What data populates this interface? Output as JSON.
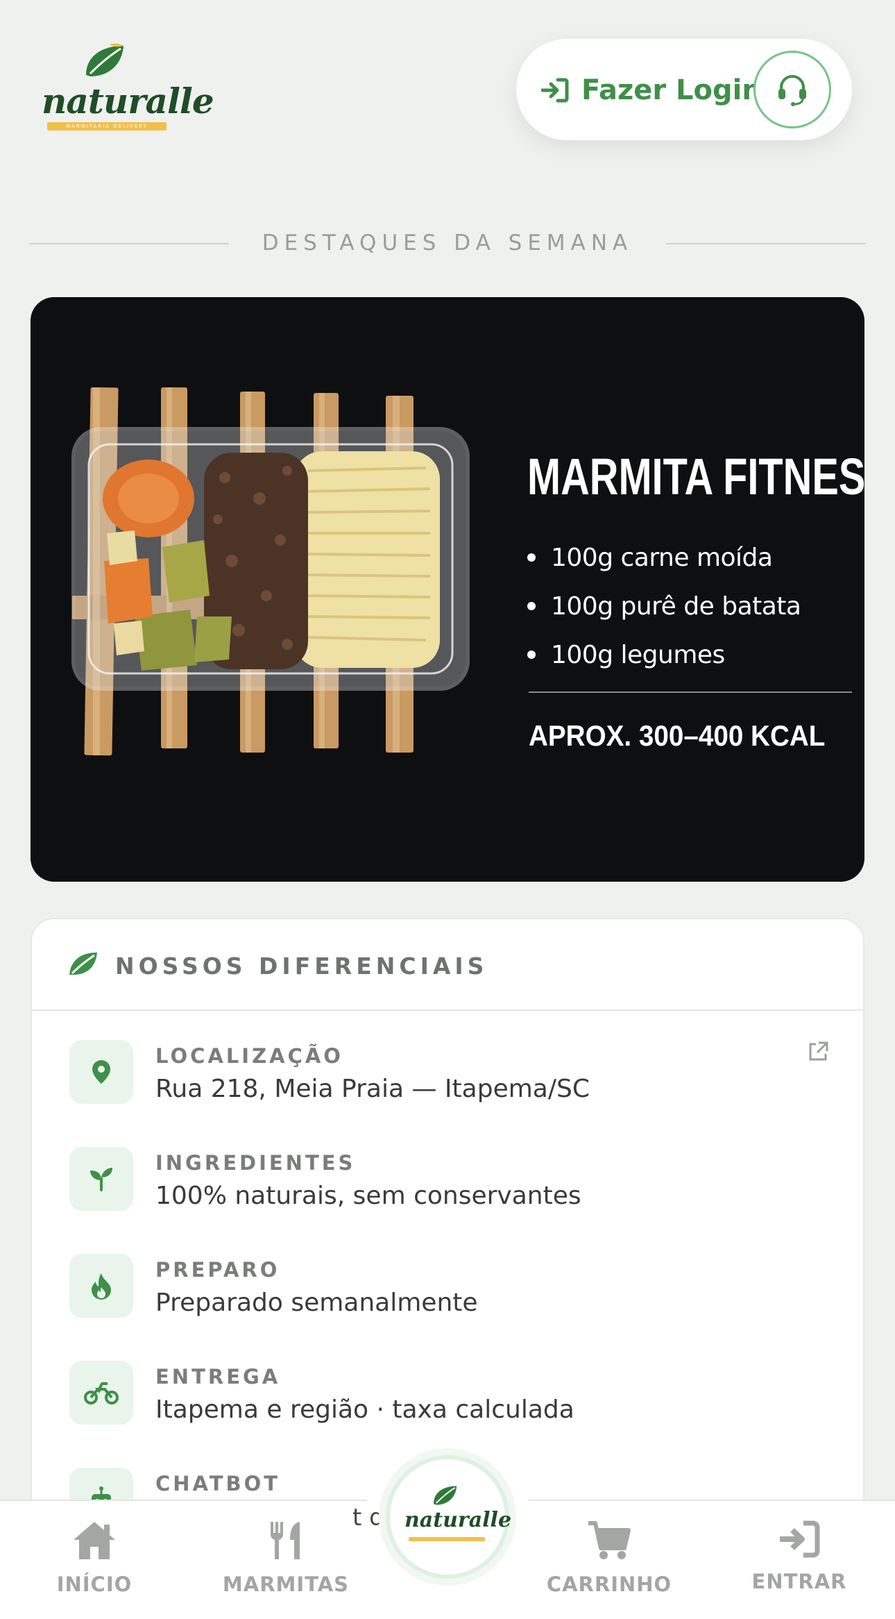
{
  "brand": {
    "name": "naturalle",
    "tagline": "MARMITARIA DELIVERY"
  },
  "header": {
    "login_label": "Fazer Login"
  },
  "section": {
    "title": "DESTAQUES DA SEMANA"
  },
  "featured": {
    "title": "MARMITA FITNESS",
    "items": [
      "100g carne moída",
      "100g purê de batata",
      "100g legumes"
    ],
    "kcal": "APROX. 300–400 KCAL"
  },
  "diferenciais": {
    "title": "NOSSOS DIFERENCIAIS",
    "items": [
      {
        "label": "LOCALIZAÇÃO",
        "value": "Rua 218, Meia Praia — Itapema/SC",
        "icon": "location-pin-icon"
      },
      {
        "label": "INGREDIENTES",
        "value": "100% naturais, sem conservantes",
        "icon": "sprout-icon"
      },
      {
        "label": "PREPARO",
        "value": "Preparado semanalmente",
        "icon": "flame-icon"
      },
      {
        "label": "ENTREGA",
        "value": "Itapema e região · taxa calculada",
        "icon": "motorcycle-icon"
      },
      {
        "label": "CHATBOT",
        "value": "",
        "icon": "robot-icon"
      }
    ]
  },
  "nav": {
    "items": [
      "INÍCIO",
      "MARMITAS",
      "CARRINHO",
      "ENTRAR"
    ],
    "peek_text": "t                       dú"
  },
  "colors": {
    "accent": "#3f8f49",
    "background": "#eff1ef",
    "card_dark": "#0e0f10"
  }
}
